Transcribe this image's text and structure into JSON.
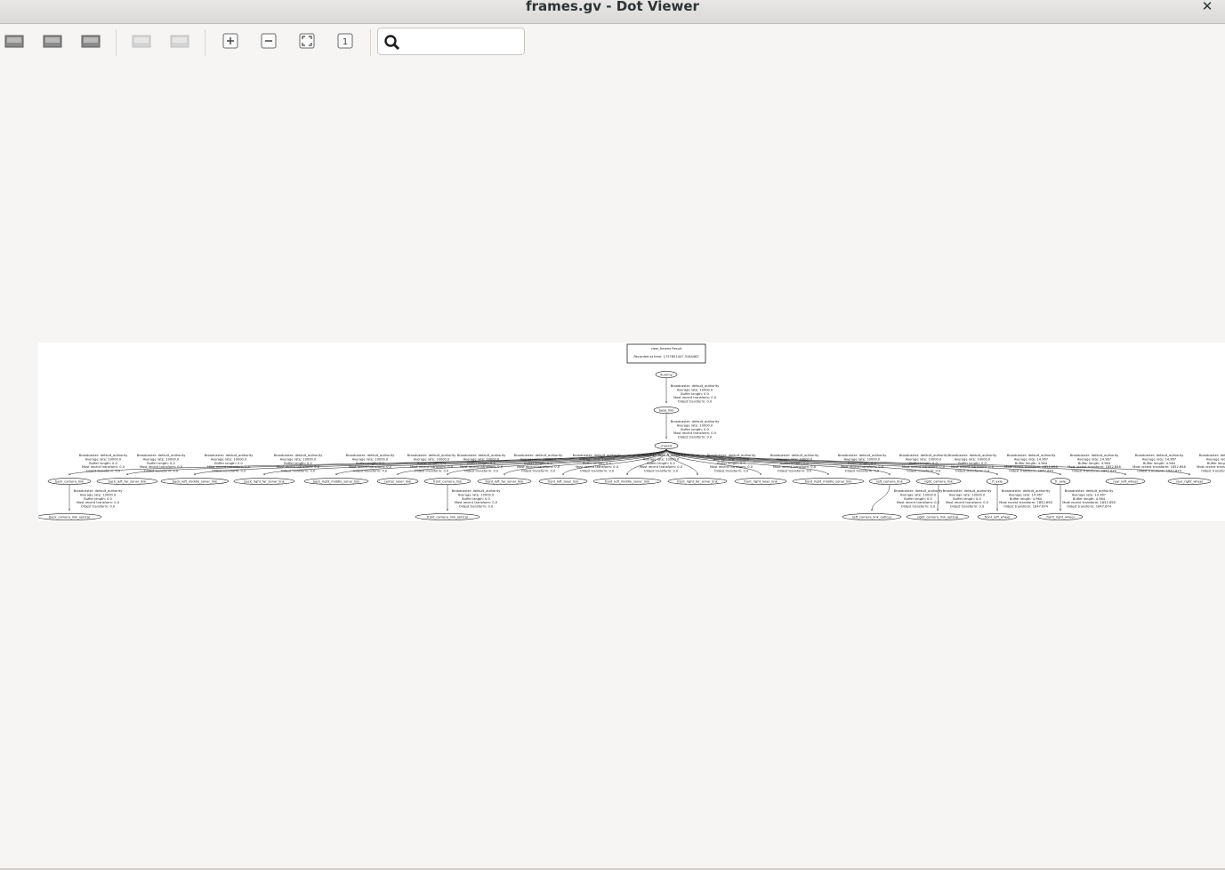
{
  "window": {
    "title": "frames.gv - Dot Viewer",
    "close_label": "✕"
  },
  "toolbar": {
    "buttons": [
      {
        "name": "open-button",
        "icon": "open-icon",
        "enabled": true
      },
      {
        "name": "export-button",
        "icon": "export-icon",
        "enabled": true
      },
      {
        "name": "refresh-button",
        "icon": "refresh-icon",
        "enabled": true
      },
      {
        "name": "back-button",
        "icon": "back-icon",
        "enabled": false
      },
      {
        "name": "forward-button",
        "icon": "forward-icon",
        "enabled": false
      },
      {
        "name": "zoom-in-button",
        "icon": "zoom-in-icon",
        "enabled": true
      },
      {
        "name": "zoom-out-button",
        "icon": "zoom-out-icon",
        "enabled": true
      },
      {
        "name": "zoom-fit-button",
        "icon": "zoom-fit-icon",
        "enabled": true
      },
      {
        "name": "zoom-100-button",
        "icon": "zoom-100-icon",
        "enabled": true
      }
    ],
    "search": {
      "value": "",
      "placeholder": ""
    }
  },
  "graph": {
    "header": {
      "title": "view_frames Result",
      "subtitle": "Recorded at time: 1757851407.3184462"
    },
    "edge_label_static": [
      "Broadcaster: default_authority",
      "Average rate: 10000.0",
      "Buffer length: 0.0",
      "Most recent transform: 0.0",
      "Oldest transform: 0.0"
    ],
    "edge_label_dynamic": [
      "Broadcaster: default_authority",
      "Average rate: 14.967",
      "Buffer length: 4.964",
      "Most recent transform: 1852.658",
      "Oldest transform: 1847.674"
    ],
    "nodes": {
      "dummy": "dummy",
      "base": "base_link",
      "chassis": "chassis",
      "level1": [
        "back_camera_link",
        "back_left_far_sonar_link",
        "back_left_middle_sonar_link",
        "back_right_far_sonar_link",
        "back_right_middle_sonar_link",
        "center_laser_link",
        "front_camera_link",
        "front_left_far_sonar_link",
        "front_left_laser_link",
        "front_left_middle_sonar_link",
        "front_right_far_sonar_link",
        "front_right_laser_link",
        "front_right_middle_sonar_link",
        "left_camera_link",
        "right_camera_link",
        "fl_axle",
        "fr_axle",
        "rear_left_wheel",
        "rear_right_wheel"
      ],
      "level2": [
        "back_camera_link_optical",
        "front_camera_link_optical",
        "left_camera_link_optical",
        "right_camera_link_optical",
        "front_left_wheel",
        "front_right_wheel"
      ]
    }
  }
}
